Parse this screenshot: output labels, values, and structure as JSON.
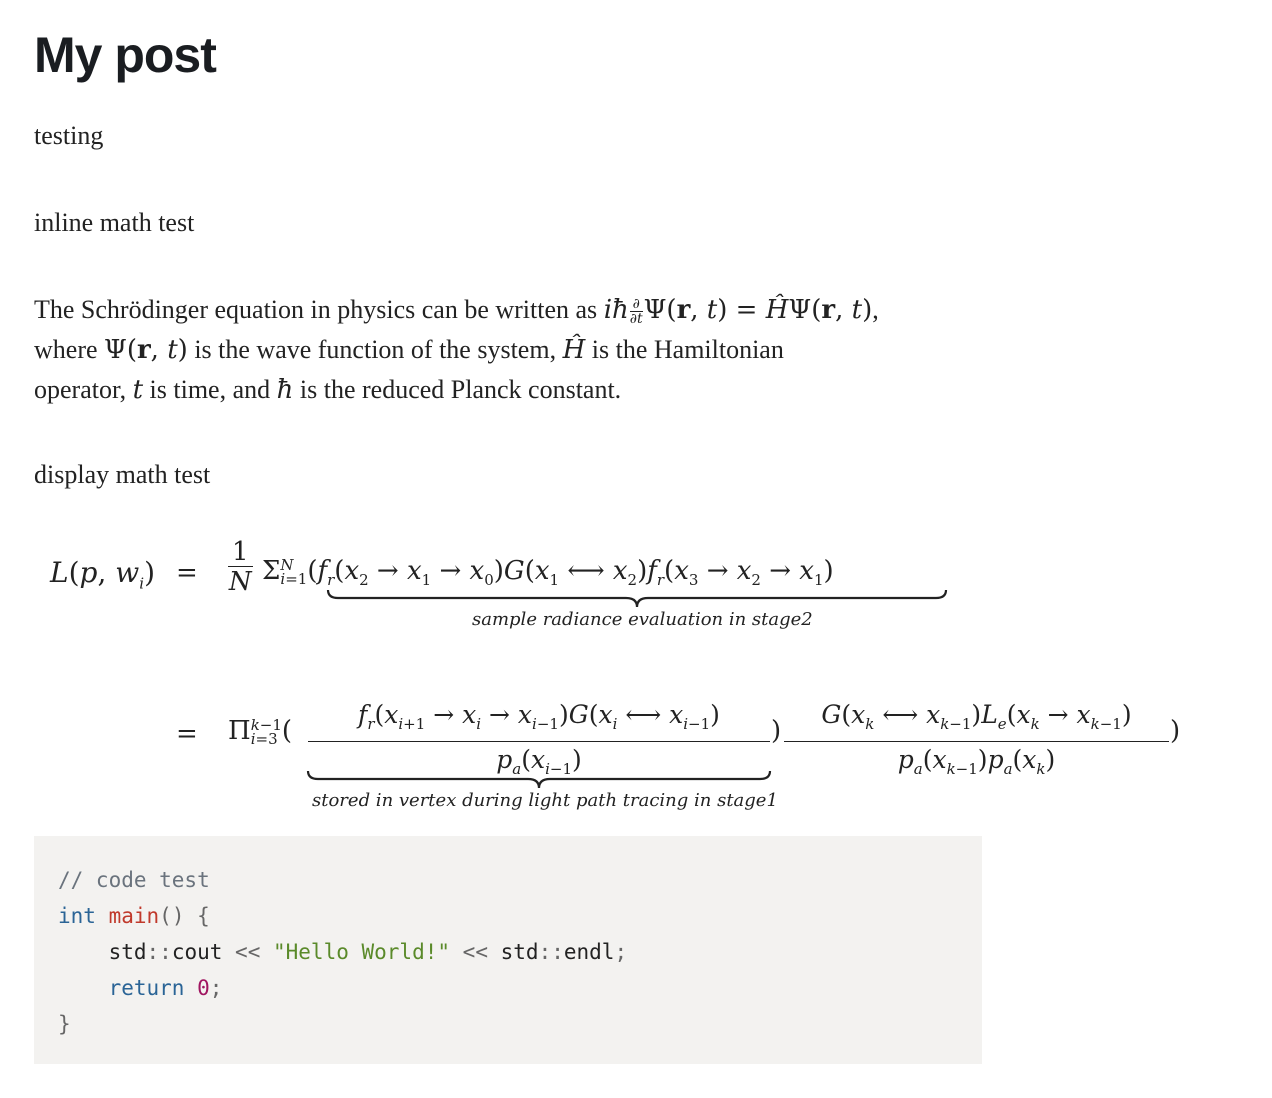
{
  "post": {
    "title": "My post",
    "p1": "testing",
    "p2": "inline math test",
    "p3": {
      "t1": "The Schrödinger equation in physics can be written as ",
      "t2": ", ",
      "t3": "where ",
      "t4": " is the wave function of the system, ",
      "t5": " is the Hamiltonian",
      "t6": "operator, ",
      "t7": " is time, and ",
      "t8": " is the reduced Planck constant."
    },
    "p4": "display math test"
  },
  "math": {
    "underbrace1": "sample radiance evaluation in stage2",
    "underbrace2": "stored in vertex during light path tracing in stage1"
  },
  "code": {
    "line1": "// code test",
    "kw_int": "int",
    "fn_main": "main",
    "paren_open": "() {",
    "std1": "std",
    "cout": "cout",
    "op1": "<<",
    "str": "\"Hello World!\"",
    "op2": "<<",
    "std2": "std",
    "endl": "endl",
    "semi": ";",
    "kw_return": "return",
    "num": "0",
    "semi2": ";",
    "close": "}"
  }
}
